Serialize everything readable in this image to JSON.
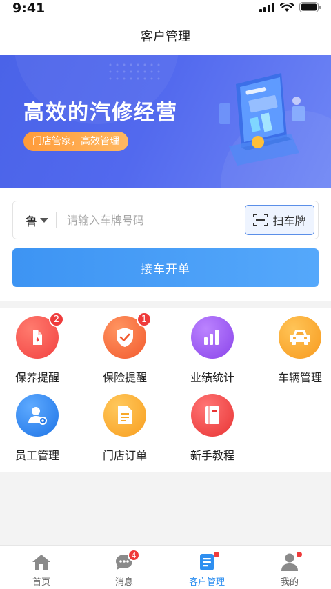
{
  "status_bar": {
    "time": "9:41"
  },
  "header": {
    "title": "客户管理"
  },
  "banner": {
    "title": "高效的汽修经营",
    "tag": "门店管家，高效管理"
  },
  "plate_search": {
    "province": "鲁",
    "placeholder": "请输入车牌号码",
    "scan_label": "扫车牌"
  },
  "submit_label": "接车开单",
  "features": [
    {
      "label": "保养提醒",
      "badge": "2",
      "icon": "oil-can-icon",
      "color": "#f5474a"
    },
    {
      "label": "保险提醒",
      "badge": "1",
      "icon": "shield-check-icon",
      "color": "#f36a3a"
    },
    {
      "label": "业绩统计",
      "icon": "bar-chart-icon",
      "color": "#9b5cf0"
    },
    {
      "label": "车辆管理",
      "icon": "car-icon",
      "color": "#f9a62a"
    },
    {
      "label": "员工管理",
      "icon": "staff-icon",
      "color": "#2e86ee"
    },
    {
      "label": "门店订单",
      "icon": "document-icon",
      "color": "#f8a829"
    },
    {
      "label": "新手教程",
      "icon": "book-icon",
      "color": "#f24748"
    }
  ],
  "tabs": [
    {
      "label": "首页",
      "icon": "home-icon"
    },
    {
      "label": "消息",
      "icon": "chat-icon",
      "badge": "4"
    },
    {
      "label": "客户管理",
      "icon": "customer-list-icon",
      "active": true,
      "dot": true
    },
    {
      "label": "我的",
      "icon": "profile-icon",
      "dot": true
    }
  ],
  "colors": {
    "accent": "#2e8ff0",
    "banner": "#4a63e8",
    "badge": "#ef3b3b",
    "tag": "#ff9b3a"
  }
}
